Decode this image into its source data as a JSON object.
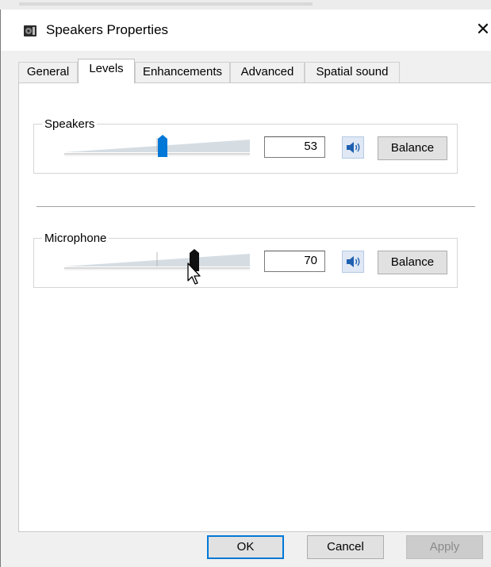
{
  "dialog": {
    "title": "Speakers Properties",
    "close_glyph": "✕"
  },
  "tabs": [
    {
      "label": "General",
      "active": false
    },
    {
      "label": "Levels",
      "active": true
    },
    {
      "label": "Enhancements",
      "active": false
    },
    {
      "label": "Advanced",
      "active": false
    },
    {
      "label": "Spatial sound",
      "active": false
    }
  ],
  "levels": {
    "speakers": {
      "label": "Speakers",
      "value": "53",
      "slider_fraction": 0.53,
      "thumb_color": "#0078d7",
      "mute_icon": "speaker-icon",
      "balance_label": "Balance"
    },
    "microphone": {
      "label": "Microphone",
      "value": "70",
      "slider_fraction": 0.7,
      "thumb_color": "#111111",
      "mute_icon": "speaker-icon",
      "balance_label": "Balance"
    }
  },
  "footer": {
    "ok_label": "OK",
    "cancel_label": "Cancel",
    "apply_label": "Apply"
  },
  "colors": {
    "accent": "#0078d7",
    "panel": "#ffffff",
    "dialog_bg": "#f0f0f0"
  }
}
